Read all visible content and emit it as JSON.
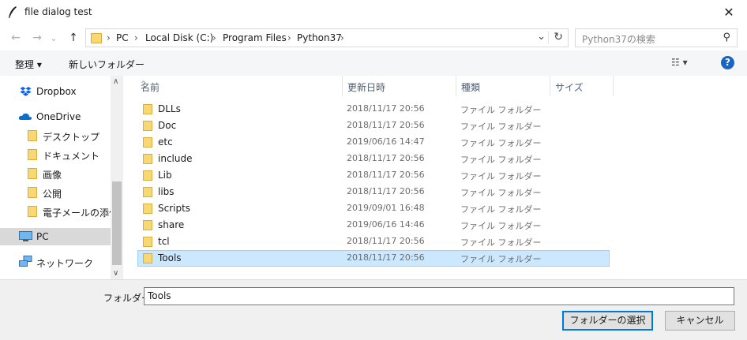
{
  "window": {
    "title": "file dialog test",
    "close_glyph": "✕"
  },
  "nav": {
    "back_glyph": "←",
    "forward_glyph": "→",
    "recent_glyph": "⌄",
    "up_glyph": "↑",
    "breadcrumb": [
      "PC",
      "Local Disk (C:)",
      "Program Files",
      "Python37"
    ],
    "separator": "›",
    "dropdown_glyph": "⌄",
    "refresh_glyph": "↻",
    "search_placeholder": "Python37の検索",
    "search_glyph": "⚲"
  },
  "toolbar": {
    "organize_label": "整理 ▾",
    "new_folder_label": "新しいフォルダー",
    "view_label": "☷ ▾",
    "help_label": "?"
  },
  "sidebar": {
    "items": [
      {
        "label": "Dropbox",
        "icon": "dropbox-icon"
      },
      {
        "label": "OneDrive",
        "icon": "onedrive-icon"
      },
      {
        "label": "デスクトップ",
        "icon": "folder-icon"
      },
      {
        "label": "ドキュメント",
        "icon": "folder-icon"
      },
      {
        "label": "画像",
        "icon": "folder-icon"
      },
      {
        "label": "公開",
        "icon": "folder-icon"
      },
      {
        "label": "電子メールの添付フ",
        "icon": "folder-icon"
      },
      {
        "label": "PC",
        "icon": "pc-icon"
      },
      {
        "label": "ネットワーク",
        "icon": "network-icon"
      }
    ],
    "scroll_up": "∧",
    "scroll_down": "∨"
  },
  "columns": {
    "name": "名前",
    "date": "更新日時",
    "type": "種類",
    "size": "サイズ",
    "sort_caret": "^"
  },
  "files": [
    {
      "name": "DLLs",
      "date": "2018/11/17 20:56",
      "type": "ファイル フォルダー"
    },
    {
      "name": "Doc",
      "date": "2018/11/17 20:56",
      "type": "ファイル フォルダー"
    },
    {
      "name": "etc",
      "date": "2019/06/16 14:47",
      "type": "ファイル フォルダー"
    },
    {
      "name": "include",
      "date": "2018/11/17 20:56",
      "type": "ファイル フォルダー"
    },
    {
      "name": "Lib",
      "date": "2018/11/17 20:56",
      "type": "ファイル フォルダー"
    },
    {
      "name": "libs",
      "date": "2018/11/17 20:56",
      "type": "ファイル フォルダー"
    },
    {
      "name": "Scripts",
      "date": "2019/09/01 16:48",
      "type": "ファイル フォルダー"
    },
    {
      "name": "share",
      "date": "2019/06/16 14:46",
      "type": "ファイル フォルダー"
    },
    {
      "name": "tcl",
      "date": "2018/11/17 20:56",
      "type": "ファイル フォルダー"
    },
    {
      "name": "Tools",
      "date": "2018/11/17 20:56",
      "type": "ファイル フォルダー"
    }
  ],
  "footer": {
    "folder_label": "フォルダー:",
    "folder_value": "Tools",
    "select_button": "フォルダーの選択",
    "cancel_button": "キャンセル"
  },
  "colors": {
    "selection": "#cce8ff",
    "accent": "#0078d7",
    "folder": "#f8d775"
  }
}
